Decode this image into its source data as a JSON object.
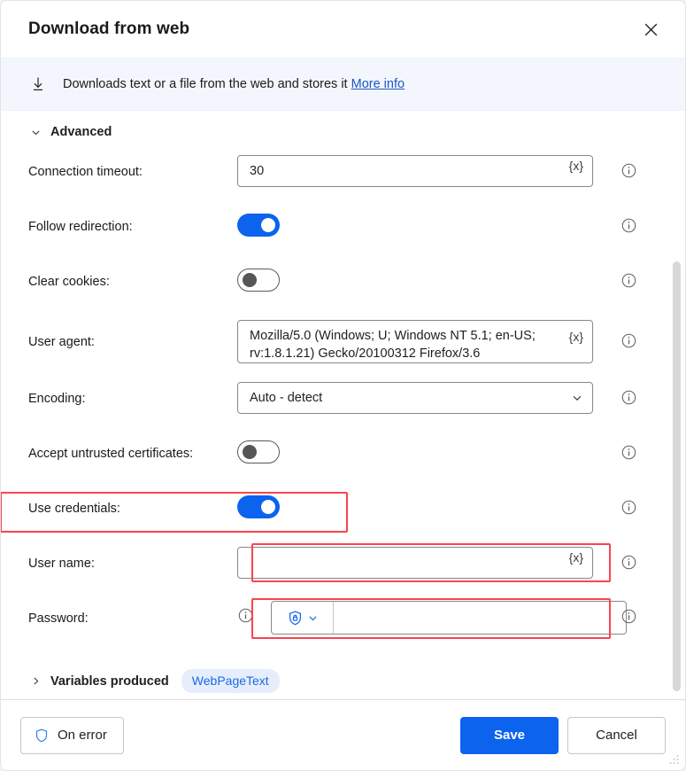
{
  "window": {
    "title": "Download from web",
    "close_icon": "close-icon",
    "resize_grip": "resize-grip"
  },
  "banner": {
    "icon": "download-icon",
    "text": "Downloads text or a file from the web and stores it",
    "link_label": "More info"
  },
  "advanced_section": {
    "title": "Advanced",
    "expanded": true,
    "chevron_icon": "chevron-down-icon",
    "fields": [
      {
        "label": "Connection timeout:",
        "type": "text",
        "value": "30",
        "variable_button": "{x}",
        "info_icon": "info-icon",
        "highlighted": false
      },
      {
        "label": "Follow redirection:",
        "type": "toggle",
        "value": "on",
        "info_icon": "info-icon",
        "highlighted": false
      },
      {
        "label": "Clear cookies:",
        "type": "toggle",
        "value": "off",
        "info_icon": "info-icon",
        "highlighted": false
      },
      {
        "label": "User agent:",
        "type": "textarea",
        "value": "Mozilla/5.0 (Windows; U; Windows NT 5.1; en-US; rv:1.8.1.21) Gecko/20100312 Firefox/3.6",
        "variable_button": "{x}",
        "info_icon": "info-icon",
        "highlighted": false
      },
      {
        "label": "Encoding:",
        "type": "dropdown",
        "value": "Auto - detect",
        "chevron_icon": "chevron-down-icon",
        "info_icon": "info-icon",
        "highlighted": false
      },
      {
        "label": "Accept untrusted certificates:",
        "type": "toggle",
        "value": "off",
        "info_icon": "info-icon",
        "highlighted": false
      },
      {
        "label": "Use credentials:",
        "type": "toggle",
        "value": "on",
        "info_icon": "info-icon",
        "highlighted": true
      },
      {
        "label": "User name:",
        "type": "text",
        "value": "",
        "variable_button": "{x}",
        "info_icon": "info-icon",
        "highlighted": true
      },
      {
        "label": "Password:",
        "type": "password",
        "value": "",
        "secure_icon": "shield-lock-icon",
        "chevron_icon": "chevron-down-icon",
        "leading_info_icon": "info-icon",
        "info_icon": "info-icon",
        "highlighted": true
      }
    ]
  },
  "variables_section": {
    "chevron_icon": "chevron-right-icon",
    "title": "Variables produced",
    "chips": [
      "WebPageText"
    ]
  },
  "footer": {
    "on_error_label": "On error",
    "on_error_icon": "shield-icon",
    "save_label": "Save",
    "cancel_label": "Cancel"
  },
  "colors": {
    "accent_blue": "#0b63ee",
    "highlight_red": "#f9454c",
    "banner_bg": "#f3f7fd",
    "link_blue": "#1b56c4",
    "chip_bg": "#e6eefc",
    "chip_text": "#1b6ae5"
  }
}
